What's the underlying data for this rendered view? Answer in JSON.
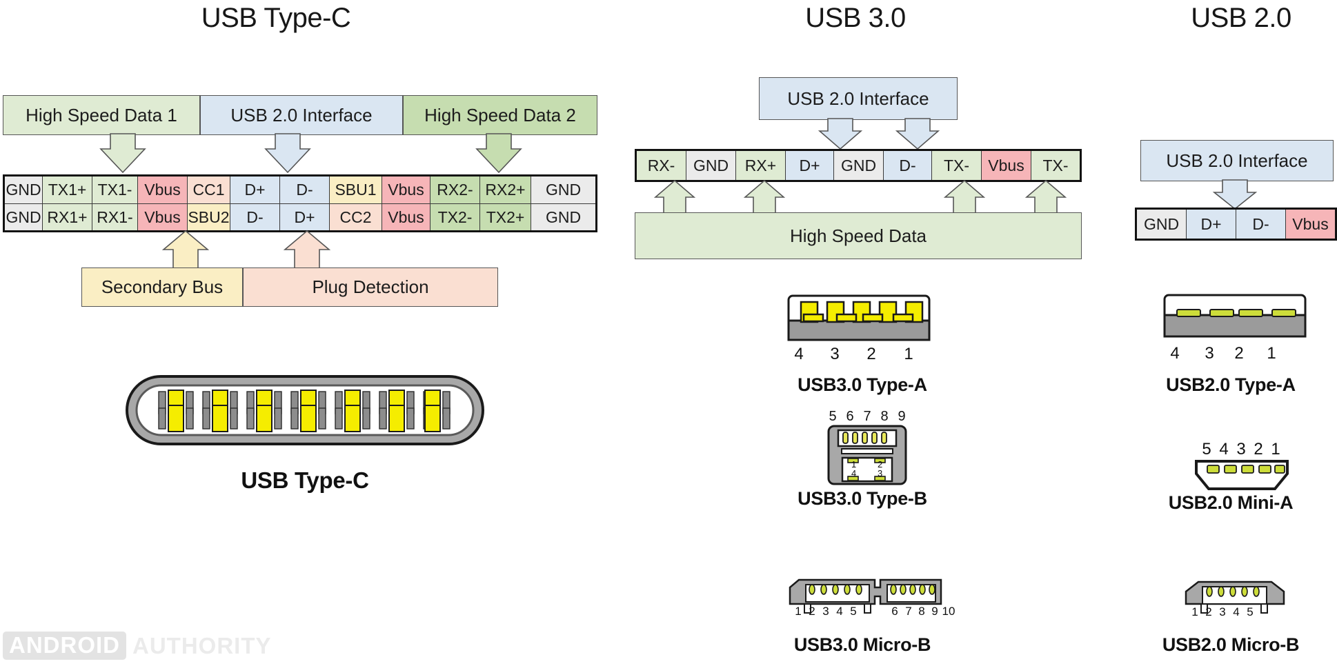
{
  "titles": {
    "typec": "USB Type-C",
    "usb30": "USB 3.0",
    "usb20": "USB 2.0"
  },
  "watermark": {
    "box": "ANDROID",
    "text": "AUTHORITY"
  },
  "colors": {
    "green_light": "#dfebd3",
    "green_mid": "#c6ddb0",
    "blue_light": "#dae6f2",
    "red_light": "#f6b5b8",
    "peach": "#fadfd2",
    "yellow_light": "#faeec4",
    "gray_light": "#ebebeb",
    "pin_yellow": "#f5ed00",
    "body_gray": "#9b9b9b",
    "border_dark": "#111111"
  },
  "typec": {
    "group_bars": [
      {
        "label": "High Speed Data 1",
        "color": "#dfebd3"
      },
      {
        "label": "USB 2.0 Interface",
        "color": "#dae6f2"
      },
      {
        "label": "High Speed Data 2",
        "color": "#c6ddb0"
      }
    ],
    "pin_table": {
      "row_a": [
        {
          "label": "GND",
          "color": "#ebebeb"
        },
        {
          "label": "TX1+",
          "color": "#dfebd3"
        },
        {
          "label": "TX1-",
          "color": "#dfebd3"
        },
        {
          "label": "Vbus",
          "color": "#f6b5b8"
        },
        {
          "label": "CC1",
          "color": "#fadfd2"
        },
        {
          "label": "D+",
          "color": "#dae6f2"
        },
        {
          "label": "D-",
          "color": "#dae6f2"
        },
        {
          "label": "SBU1",
          "color": "#faeec4"
        },
        {
          "label": "Vbus",
          "color": "#f6b5b8"
        },
        {
          "label": "RX2-",
          "color": "#c6ddb0"
        },
        {
          "label": "RX2+",
          "color": "#c6ddb0"
        },
        {
          "label": "GND",
          "color": "#ebebeb"
        }
      ],
      "row_b": [
        {
          "label": "GND",
          "color": "#ebebeb"
        },
        {
          "label": "RX1+",
          "color": "#dfebd3"
        },
        {
          "label": "RX1-",
          "color": "#dfebd3"
        },
        {
          "label": "Vbus",
          "color": "#f6b5b8"
        },
        {
          "label": "SBU2",
          "color": "#faeec4"
        },
        {
          "label": "D-",
          "color": "#dae6f2"
        },
        {
          "label": "D+",
          "color": "#dae6f2"
        },
        {
          "label": "CC2",
          "color": "#fadfd2"
        },
        {
          "label": "Vbus",
          "color": "#f6b5b8"
        },
        {
          "label": "TX2-",
          "color": "#c6ddb0"
        },
        {
          "label": "TX2+",
          "color": "#c6ddb0"
        },
        {
          "label": "GND",
          "color": "#ebebeb"
        }
      ]
    },
    "bottom_bars": [
      {
        "label": "Secondary Bus",
        "color": "#faeec4"
      },
      {
        "label": "Plug Detection",
        "color": "#fadfd2"
      }
    ],
    "connector_caption": "USB Type-C"
  },
  "usb30": {
    "top_box": {
      "label": "USB 2.0 Interface",
      "color": "#dae6f2"
    },
    "pin_row": [
      {
        "label": "RX-",
        "color": "#dfebd3"
      },
      {
        "label": "GND",
        "color": "#ebebeb"
      },
      {
        "label": "RX+",
        "color": "#dfebd3"
      },
      {
        "label": "D+",
        "color": "#dae6f2"
      },
      {
        "label": "GND",
        "color": "#ebebeb"
      },
      {
        "label": "D-",
        "color": "#dae6f2"
      },
      {
        "label": "TX-",
        "color": "#dfebd3"
      },
      {
        "label": "Vbus",
        "color": "#f6b5b8"
      },
      {
        "label": "TX-",
        "color": "#dfebd3"
      }
    ],
    "bottom_box": {
      "label": "High Speed Data",
      "color": "#dfebd3"
    },
    "connectors": [
      {
        "caption": "USB3.0 Type-A",
        "pins": [
          "4",
          "3",
          "2",
          "1"
        ]
      },
      {
        "caption": "USB3.0 Type-B",
        "pins_top": [
          "5",
          "6",
          "7",
          "8",
          "9"
        ],
        "pins_inner": [
          "1",
          "2",
          "4",
          "3"
        ]
      },
      {
        "caption": "USB3.0 Micro-B",
        "pins_left": [
          "1",
          "2",
          "3",
          "4",
          "5"
        ],
        "pins_right": [
          "6",
          "7",
          "8",
          "9",
          "10"
        ]
      }
    ]
  },
  "usb20": {
    "top_box": {
      "label": "USB 2.0 Interface",
      "color": "#dae6f2"
    },
    "pin_row": [
      {
        "label": "GND",
        "color": "#ebebeb"
      },
      {
        "label": "D+",
        "color": "#dae6f2"
      },
      {
        "label": "D-",
        "color": "#dae6f2"
      },
      {
        "label": "Vbus",
        "color": "#f6b5b8"
      }
    ],
    "connectors": [
      {
        "caption": "USB2.0 Type-A",
        "pins": [
          "4",
          "3",
          "2",
          "1"
        ]
      },
      {
        "caption": "USB2.0 Mini-A",
        "pins": [
          "5",
          "4",
          "3",
          "2",
          "1"
        ]
      },
      {
        "caption": "USB2.0 Micro-B",
        "pins": [
          "1",
          "2",
          "3",
          "4",
          "5"
        ]
      }
    ]
  }
}
